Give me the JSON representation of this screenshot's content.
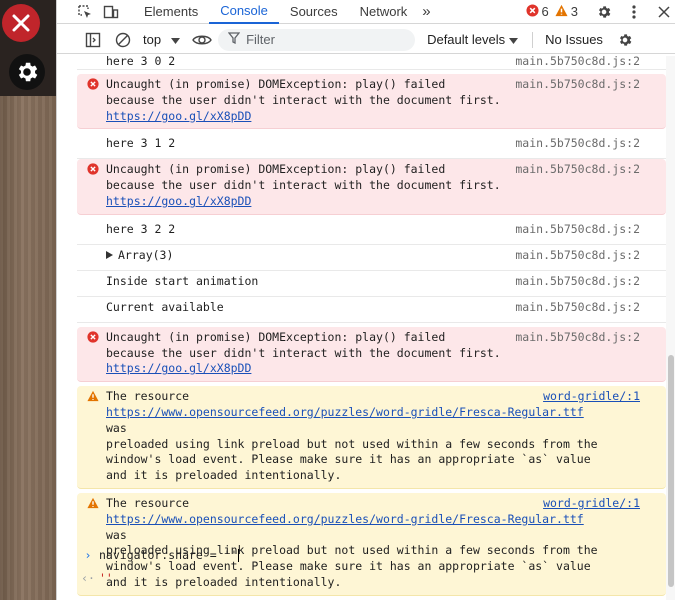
{
  "tabs": [
    {
      "label": "Elements"
    },
    {
      "label": "Console"
    },
    {
      "label": "Sources"
    },
    {
      "label": "Network"
    }
  ],
  "more_tabs": "»",
  "counts": {
    "errors": "6",
    "warnings": "3"
  },
  "toolbar": {
    "context": "top",
    "filter_placeholder": "Filter",
    "levels": "Default levels",
    "issues": "No Issues"
  },
  "colors": {
    "accent": "#1a64d6",
    "error_bg": "#fde7e9",
    "warn_bg": "#fef6d5"
  },
  "messages": [
    {
      "type": "log",
      "text": "here 3 0 2",
      "source": "main.5b750c8d.js:2"
    },
    {
      "type": "error",
      "line1": "Uncaught (in promise) DOMException: play() failed",
      "line2": "because the user didn't interact with the document first.",
      "link": "https://goo.gl/xX8pDD",
      "source": "main.5b750c8d.js:2"
    },
    {
      "type": "log",
      "text": "here 3 1 2",
      "source": "main.5b750c8d.js:2"
    },
    {
      "type": "error",
      "line1": "Uncaught (in promise) DOMException: play() failed",
      "line2": "because the user didn't interact with the document first.",
      "link": "https://goo.gl/xX8pDD",
      "source": "main.5b750c8d.js:2"
    },
    {
      "type": "log",
      "text": "here 3 2 2",
      "source": "main.5b750c8d.js:2"
    },
    {
      "type": "log",
      "text": "Array(3)",
      "source": "main.5b750c8d.js:2"
    },
    {
      "type": "log",
      "text": "Inside start animation",
      "source": "main.5b750c8d.js:2"
    },
    {
      "type": "log",
      "text": "Current available",
      "source": "main.5b750c8d.js:2"
    },
    {
      "type": "error",
      "line1": "Uncaught (in promise) DOMException: play() failed",
      "line2": "because the user didn't interact with the document first.",
      "link": "https://goo.gl/xX8pDD",
      "source": "main.5b750c8d.js:2"
    },
    {
      "type": "warning",
      "line1": "The resource",
      "link": "https://www.opensourcefeed.org/puzzles/word-gridle/Fresca-Regular.ttf",
      "link_tail": " was",
      "line3": "preloaded using link preload but not used within a few seconds from the",
      "line4": "window's load event. Please make sure it has an appropriate `as` value",
      "line5": "and it is preloaded intentionally.",
      "source": "word-gridle/:1"
    },
    {
      "type": "warning",
      "line1": "The resource",
      "link": "https://www.opensourcefeed.org/puzzles/word-gridle/Fresca-Regular.ttf",
      "link_tail": " was",
      "line3": "preloaded using link preload but not used within a few seconds from the",
      "line4": "window's load event. Please make sure it has an appropriate `as` value",
      "line5": "and it is preloaded intentionally.",
      "source": "word-gridle/:1"
    }
  ],
  "prompt": {
    "input": "navigator.share = ''",
    "result": "''"
  }
}
